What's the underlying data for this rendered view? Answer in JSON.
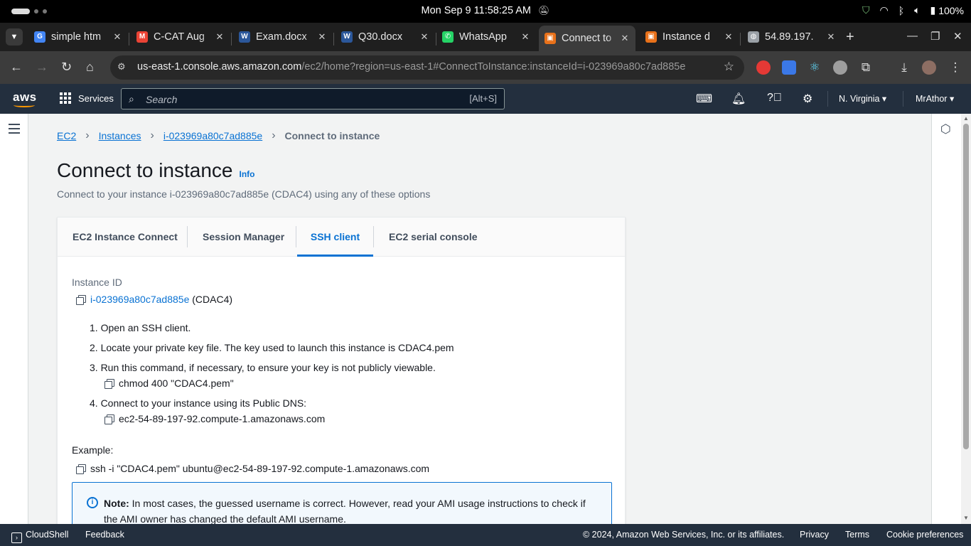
{
  "system": {
    "clock": "Mon Sep 9  11:58:25 AM",
    "battery": "100%"
  },
  "browser": {
    "tabs": [
      {
        "title": "simple htm",
        "favicon": "google-icon",
        "color": "#4285f4"
      },
      {
        "title": "C-CAT Aug",
        "favicon": "gmail-icon",
        "color": "#ea4335"
      },
      {
        "title": "Exam.docx",
        "favicon": "word-icon",
        "color": "#2b579a"
      },
      {
        "title": "Q30.docx",
        "favicon": "word-icon",
        "color": "#2b579a"
      },
      {
        "title": "WhatsApp",
        "favicon": "whatsapp-icon",
        "color": "#25d366"
      },
      {
        "title": "Connect to",
        "favicon": "aws-ec2-icon",
        "color": "#e8711a"
      },
      {
        "title": "Instance d",
        "favicon": "aws-ec2-icon",
        "color": "#e8711a"
      },
      {
        "title": "54.89.197.",
        "favicon": "globe-icon",
        "color": "#9aa0a6"
      }
    ],
    "url_host": "us-east-1.console.aws.amazon.com",
    "url_path": "/ec2/home?region=us-east-1#ConnectToInstance:instanceId=i-023969a80c7ad885e"
  },
  "aws_header": {
    "logo": "aws",
    "services_label": "Services",
    "search_placeholder": "Search",
    "search_hint": "[Alt+S]",
    "region": "N. Virginia",
    "account": "MrAthor"
  },
  "breadcrumb": {
    "items": [
      "EC2",
      "Instances",
      "i-023969a80c7ad885e"
    ],
    "current": "Connect to instance"
  },
  "page": {
    "title": "Connect to instance",
    "info_link": "Info",
    "subtitle": "Connect to your instance i-023969a80c7ad885e (CDAC4) using any of these options"
  },
  "tabs": [
    {
      "label": "EC2 Instance Connect",
      "active": false
    },
    {
      "label": "Session Manager",
      "active": false
    },
    {
      "label": "SSH client",
      "active": true
    },
    {
      "label": "EC2 serial console",
      "active": false
    }
  ],
  "ssh": {
    "instance_id_label": "Instance ID",
    "instance_id": "i-023969a80c7ad885e",
    "instance_name": "(CDAC4)",
    "steps": [
      "1. Open an SSH client.",
      "2. Locate your private key file. The key used to launch this instance is CDAC4.pem",
      "3. Run this command, if necessary, to ensure your key is not publicly viewable.",
      "4. Connect to your instance using its Public DNS:"
    ],
    "chmod_command": "chmod 400 \"CDAC4.pem\"",
    "public_dns": "ec2-54-89-197-92.compute-1.amazonaws.com",
    "example_label": "Example:",
    "example_command": "ssh -i \"CDAC4.pem\" ubuntu@ec2-54-89-197-92.compute-1.amazonaws.com",
    "note_bold": "Note:",
    "note_text": " In most cases, the guessed username is correct. However, read your AMI usage instructions to check if the AMI owner has changed the default AMI username."
  },
  "footer": {
    "cloudshell": "CloudShell",
    "feedback": "Feedback",
    "copyright": "© 2024, Amazon Web Services, Inc. or its affiliates.",
    "privacy": "Privacy",
    "terms": "Terms",
    "cookies": "Cookie preferences"
  }
}
